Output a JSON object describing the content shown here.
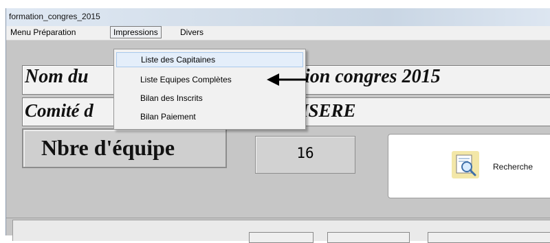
{
  "window": {
    "title": "formation_congres_2015"
  },
  "menubar": {
    "items": [
      {
        "label": "Menu Préparation"
      },
      {
        "label": "Impressions"
      },
      {
        "label": "Divers"
      }
    ]
  },
  "form": {
    "nom_text": "Nom du",
    "nom_value_text": "ion  congres  2015",
    "comite_text": "Comité d",
    "comite_value_text": "ISERE",
    "nbre_label": "Nbre d'équipe",
    "nbre_value": "16",
    "search_button_label": "Recherche"
  },
  "dropdown": {
    "items": [
      {
        "label": "Liste des Capitaines"
      },
      {
        "label": "Liste Equipes Complètes"
      },
      {
        "label": "Bilan des Inscrits"
      },
      {
        "label": "Bilan Paiement"
      }
    ]
  },
  "icons": {
    "search": "document-magnifier-icon",
    "annotation": "left-arrow-icon"
  }
}
